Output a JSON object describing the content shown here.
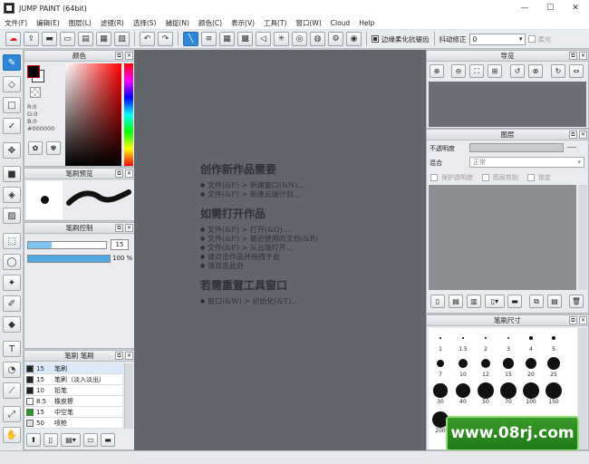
{
  "app": {
    "title": "JUMP PAINT (64bit)"
  },
  "window_controls": {
    "minimize": "—",
    "maximize": "☐",
    "close": "✕"
  },
  "menu": [
    "文件(F)",
    "编辑(E)",
    "图层(L)",
    "滤镜(R)",
    "选择(S)",
    "捕捉(N)",
    "颜色(C)",
    "表示(V)",
    "工具(T)",
    "窗口(W)",
    "Cloud",
    "Help"
  ],
  "toolbar": {
    "antialias_label": "边缘柔化抗锯齿",
    "stabilizer_label": "抖动修正",
    "stabilizer_value": "0",
    "disabled_label": "柔化"
  },
  "color_panel": {
    "title": "颜色",
    "r": "R:0",
    "g": "G:0",
    "b": "B:0",
    "hex": "#000000",
    "fg": "#000000",
    "bg": "#ffffff"
  },
  "brush_preview": {
    "title": "笔刷预览"
  },
  "brush_control": {
    "title": "笔刷控制",
    "size": "15",
    "opacity": "100",
    "opacity_unit": "%"
  },
  "brush_list": {
    "tabs": [
      "笔刷",
      "笔刷"
    ],
    "items": [
      {
        "size": "15",
        "name": "笔刷",
        "color": "#222222"
      },
      {
        "size": "15",
        "name": "笔刷（淡入淡出）",
        "color": "#222222"
      },
      {
        "size": "10",
        "name": "铅笔",
        "color": "#222222"
      },
      {
        "size": "8.5",
        "name": "橡皮擦",
        "color": "#ffffff"
      },
      {
        "size": "15",
        "name": "中空笔",
        "color": "#2a9a2a"
      },
      {
        "size": "50",
        "name": "喷枪",
        "color": "#dddddd"
      }
    ]
  },
  "welcome": {
    "h1": "创作新作品需要",
    "l1": [
      "文件(&F) > 新建窗口(&N)...",
      "文件(&F) > 新建云端计划..."
    ],
    "h2": "如需打开作品",
    "l2": [
      "文件(&F) > 打开(&O)...",
      "文件(&F) > 最近使用的文档(&R)",
      "文件(&F) > 从云端打开...",
      "请点击作品并拖拽于此",
      "请双击此处"
    ],
    "h3": "若需重置工具窗口",
    "l3": [
      "窗口(&W) > 初始化(&T)..."
    ]
  },
  "navigator": {
    "title": "导览"
  },
  "layers": {
    "title": "图层",
    "opacity_label": "不透明度",
    "blend_label": "混合",
    "blend_value": "正常",
    "protect_alpha": "保护透明度",
    "clip": "图层剪贴",
    "lock": "锁定"
  },
  "brush_size": {
    "title": "笔刷尺寸",
    "sizes": [
      "1",
      "1.5",
      "2",
      "3",
      "4",
      "5",
      "7",
      "10",
      "12",
      "15",
      "20",
      "25",
      "30",
      "40",
      "50",
      "70",
      "100",
      "150",
      "200"
    ]
  },
  "watermark": "www.08rj.com"
}
